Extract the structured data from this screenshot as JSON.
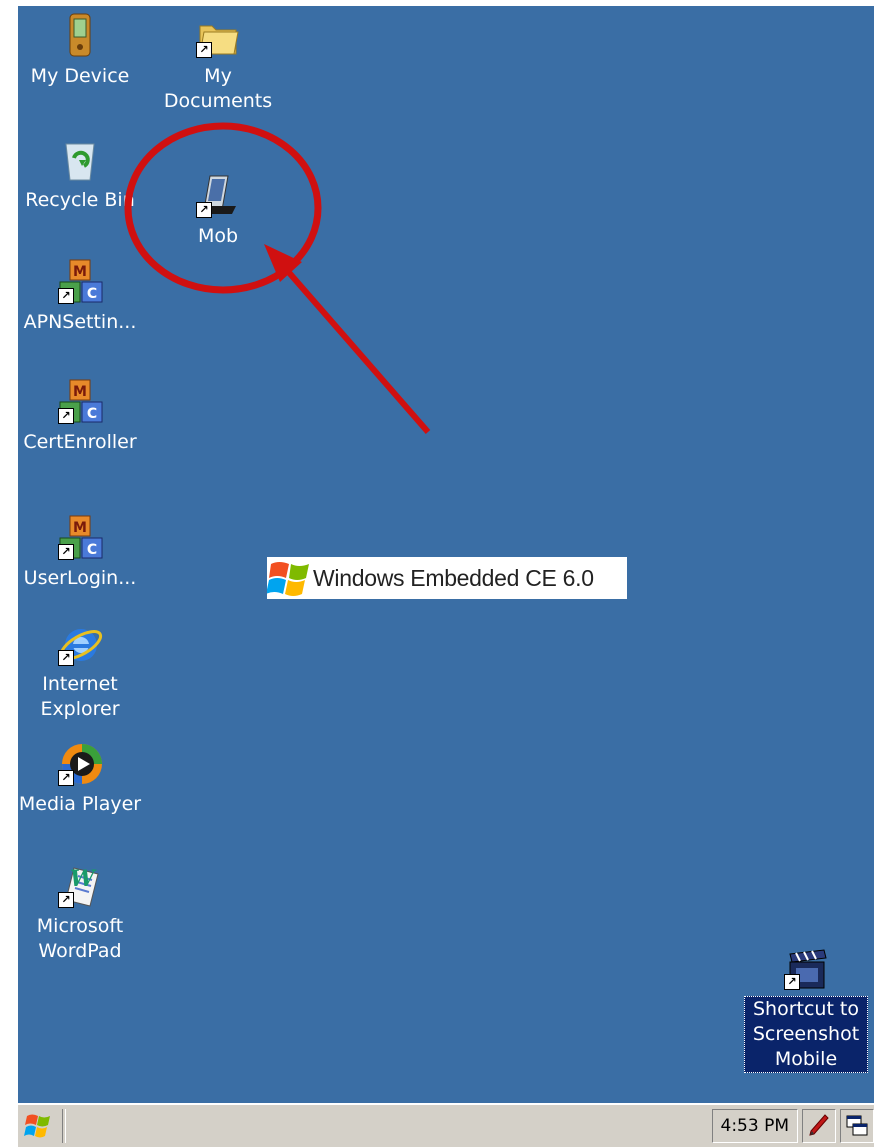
{
  "desktop": {
    "icons": [
      {
        "label": "My Device",
        "icon": "pda-device-icon"
      },
      {
        "label": "My\nDocuments",
        "icon": "folder-icon"
      },
      {
        "label": "Recycle Bin",
        "icon": "recycle-bin-icon"
      },
      {
        "label": "Mob",
        "icon": "pocket-pc-icon"
      },
      {
        "label": "APNSettin...",
        "icon": "mc-blocks-icon"
      },
      {
        "label": "CertEnroller",
        "icon": "mc-blocks-icon"
      },
      {
        "label": "UserLogin...",
        "icon": "mc-blocks-icon"
      },
      {
        "label": "Internet\nExplorer",
        "icon": "internet-explorer-icon"
      },
      {
        "label": "Media Player",
        "icon": "media-player-icon"
      },
      {
        "label": "Microsoft\nWordPad",
        "icon": "wordpad-icon"
      },
      {
        "label": "Shortcut to\nScreenshot\nMobile",
        "icon": "clapperboard-icon"
      }
    ],
    "logo_text": "Windows Embedded CE 6.0"
  },
  "taskbar": {
    "clock": "4:53 PM",
    "start_icon": "windows-flag-icon",
    "tray_icons": [
      "pen-input-icon",
      "desktop-switch-icon"
    ]
  },
  "colors": {
    "desktop": "#3a6ea5",
    "taskbar": "#d4d0c8",
    "annotation": "#d01010"
  }
}
